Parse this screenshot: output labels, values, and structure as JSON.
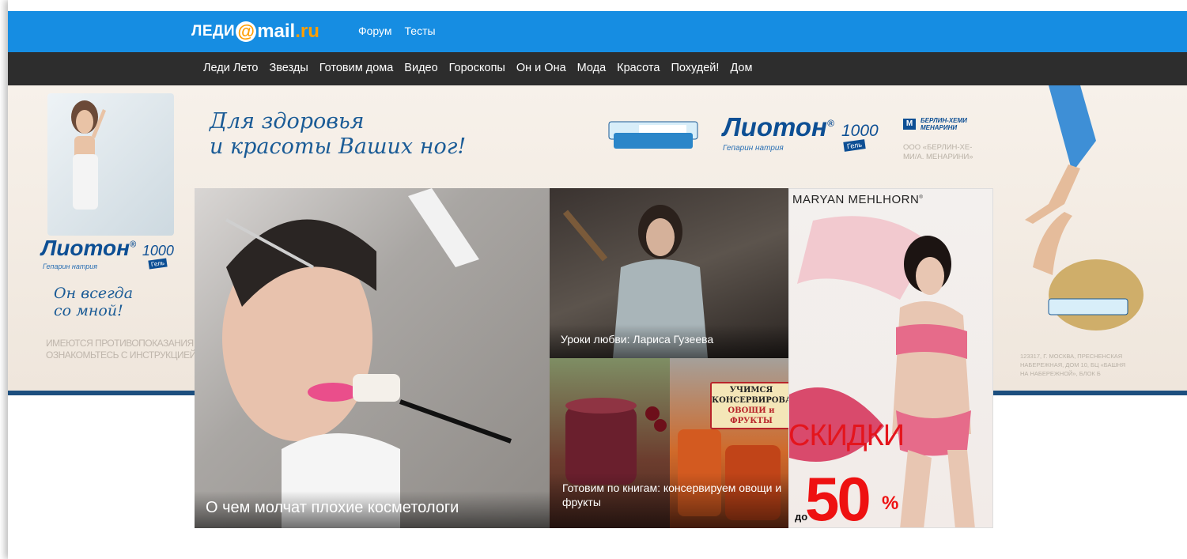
{
  "header": {
    "logo_part1": "ЛЕДИ",
    "logo_at": "@",
    "logo_part2": "mail",
    "logo_part3": ".ru",
    "links": [
      "Форум",
      "Тесты"
    ]
  },
  "nav": {
    "items": [
      "Леди Лето",
      "Звезды",
      "Готовим дома",
      "Видео",
      "Гороскопы",
      "Он и Она",
      "Мода",
      "Красота",
      "Похудей!",
      "Дом"
    ]
  },
  "ad": {
    "slogan_top": "Для здоровья\nи красоты Ваших ног!",
    "brand": "Лиотон",
    "brand_reg": "®",
    "brand_num": "1000",
    "brand_sub": "Гепарин натрия",
    "gel": "Гель",
    "company_logo": "БЕРЛИН-ХЕМИ МЕНАРИНИ",
    "company_mark": "М",
    "company_text": "ООО «БЕРЛИН-ХЕ-\nМИ/А. МЕНАРИНИ»",
    "left_slogan": "Он всегда\nсо мной!",
    "warning": "ИМЕЮТСЯ ПРОТИВОПОКАЗАНИЯ\nОЗНАКОМЬТЕСЬ С ИНСТРУКЦИЕЙ",
    "address": "123317, Г. МОСКВА, ПРЕСНЕНСКАЯ\nНАБЕРЕЖНАЯ, ДОМ 10, БЦ «БАШНЯ\nНА НАБЕРЕЖНОЙ», БЛОК Б"
  },
  "tiles": {
    "main_caption": "О чем молчат плохие косметологи",
    "top_caption": "Уроки любви: Лариса Гузеева",
    "bottom_caption": "Готовим по книгам: консервируем овощи и фрукты",
    "book_label_line1": "УЧИМСЯ",
    "book_label_line2": "КОНСЕРВИРОВАТЬ",
    "book_label_line3": "ОВОЩИ и ФРУКТЫ"
  },
  "promo": {
    "brand": "MARYAN MEHLHORN",
    "brand_reg": "®",
    "sale": "СКИДКИ",
    "prefix": "до",
    "value": "50",
    "unit": "%"
  }
}
